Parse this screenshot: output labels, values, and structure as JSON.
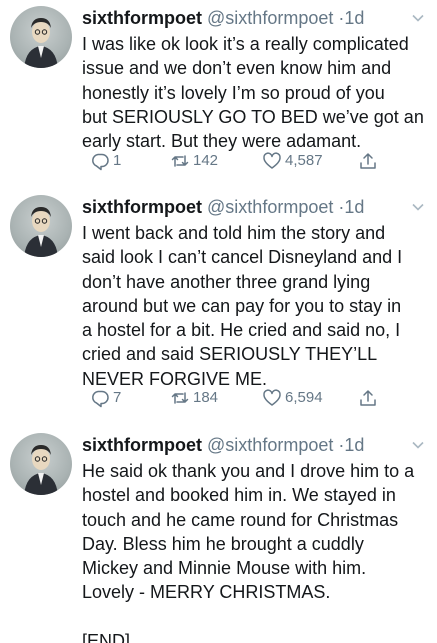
{
  "tweets": [
    {
      "author_name": "sixthformpoet",
      "author_handle": "@sixthformpoet",
      "separator": "·",
      "time": "1d",
      "text": "I was like ok look it’s a really complicated\nissue and we don’t even know him and\nhonestly it’s lovely I’m so proud of you\nbut SERIOUSLY GO TO BED we’ve got an\nearly start. But they were adamant.",
      "replies": "1",
      "retweets": "142",
      "likes": "4,587"
    },
    {
      "author_name": "sixthformpoet",
      "author_handle": "@sixthformpoet",
      "separator": "·",
      "time": "1d",
      "text": "I went back and told him the story and\nsaid look I can’t cancel Disneyland and I\ndon’t have another three grand lying\naround but we can pay for you to stay in\na hostel for a bit. He cried and said no, I\ncried and said SERIOUSLY THEY’LL\nNEVER FORGIVE ME.",
      "replies": "7",
      "retweets": "184",
      "likes": "6,594"
    },
    {
      "author_name": "sixthformpoet",
      "author_handle": "@sixthformpoet",
      "separator": "·",
      "time": "1d",
      "text": "He said ok thank you and I drove him to a\nhostel and booked him in. We stayed in\ntouch and he came round for Christmas\nDay. Bless him he brought a cuddly\nMickey and Minnie Mouse with him.\nLovely - MERRY CHRISTMAS.\n\n[END]"
    }
  ],
  "colors": {
    "text": "#14171a",
    "muted": "#657786",
    "background": "#ffffff"
  },
  "icons": [
    "reply-icon",
    "retweet-icon",
    "like-icon",
    "share-icon",
    "chevron-down-icon"
  ]
}
